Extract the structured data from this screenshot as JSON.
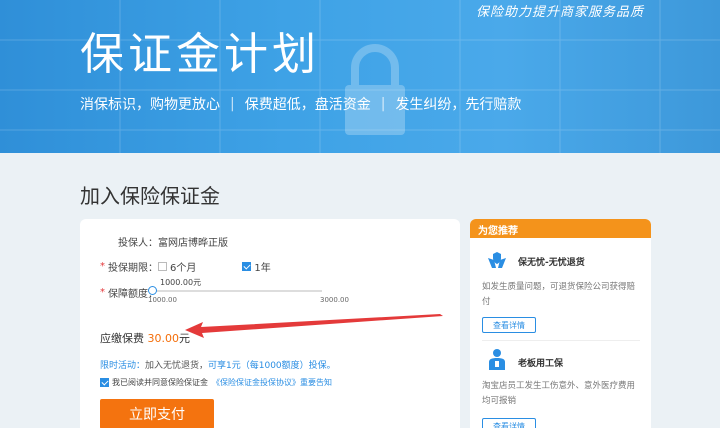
{
  "banner": {
    "slogan": "保险助力提升商家服务品质",
    "title": "保证金计划",
    "subs": [
      "消保标识，购物更放心",
      "保费超低，盘活资金",
      "发生纠纷，先行赔款"
    ],
    "sep": "|"
  },
  "page_heading": "加入保险保证金",
  "form": {
    "insured": "投保人：富网店博晔正版",
    "period_label": "投保期限：",
    "period_options": [
      "6个月",
      "1年"
    ],
    "period_selected": "1年",
    "coverage_label": "保障额度：",
    "coverage_value": "1000.00元",
    "coverage_min": "1000.00",
    "coverage_max": "3000.00",
    "coverage_level": 0.0,
    "premium_label": "应缴保费",
    "premium_amount": "30.00",
    "premium_unit": "元",
    "promo_label": "限时活动：",
    "promo_text": "加入无忧退货，",
    "promo_highlight": "可享1元（每1000额度）投保。",
    "agree_text": "我已阅读并同意保险保证金",
    "agree_link": "《保险保证金投保协议》重要告知",
    "pay_button": "立即支付"
  },
  "recommend": {
    "header": "为您推荐",
    "items": [
      {
        "title": "保无忧-无忧退货",
        "desc": "如发生质量问题，可退货保险公司获得赔付",
        "button": "查看详情"
      },
      {
        "title": "老板用工保",
        "desc": "淘宝店员工发生工伤意外、意外医疗费用均可报销",
        "button": "查看详情"
      }
    ]
  },
  "colors": {
    "accent": "#2a8ee3",
    "orange": "#f4730f",
    "banner": "#3ea2e6",
    "header": "#f4931b"
  }
}
